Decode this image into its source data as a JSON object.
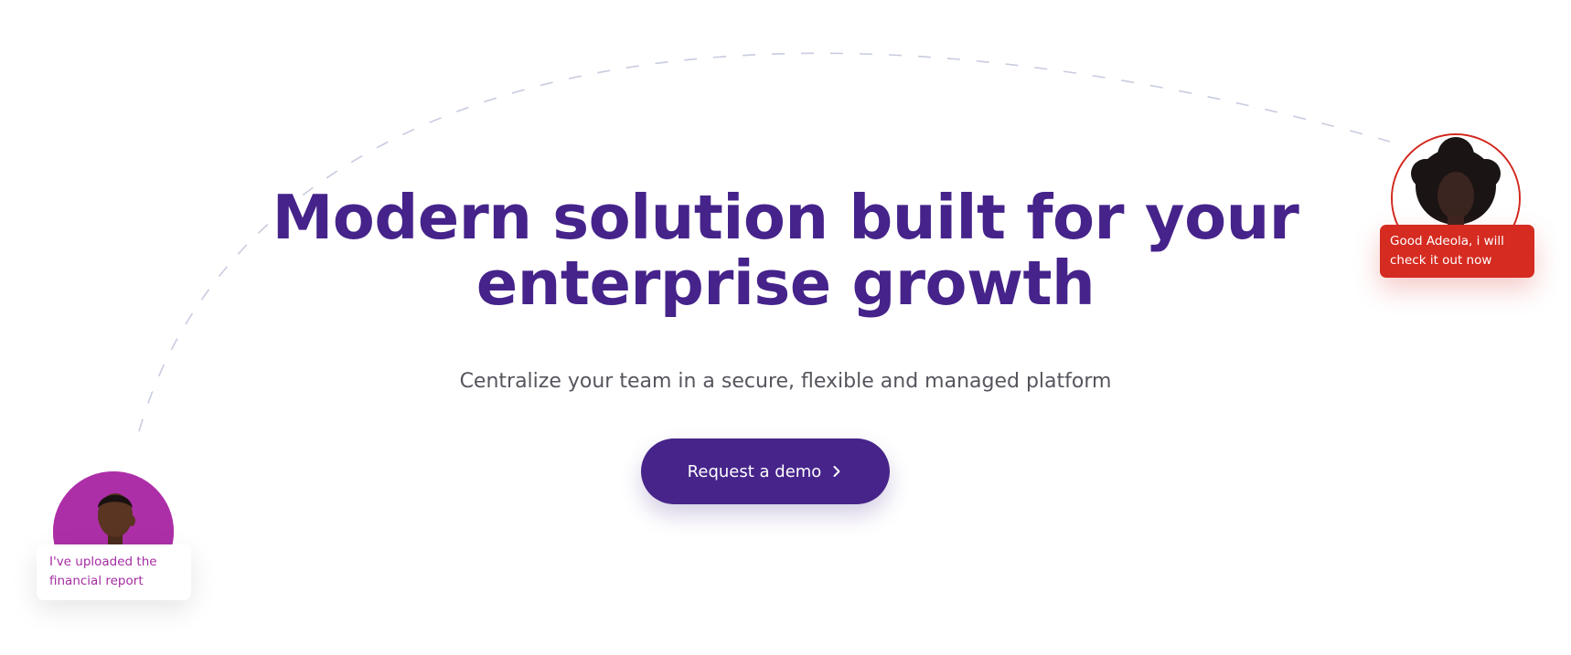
{
  "hero": {
    "headline_line1": "Modern solution built for your",
    "headline_line2": "enterprise growth",
    "subtitle": "Centralize your team in a secure, flexible and managed platform",
    "cta_label": "Request a demo"
  },
  "chat": {
    "left_message": "I've uploaded the financial report",
    "right_message": "Good Adeola, i will check it out now"
  },
  "colors": {
    "brand_purple": "#45238a",
    "magenta": "#ad2fa8",
    "alert_red": "#d52b20",
    "arc_dash": "#c9cce0"
  },
  "icons": {
    "cta_icon": "chevron-right-icon"
  }
}
